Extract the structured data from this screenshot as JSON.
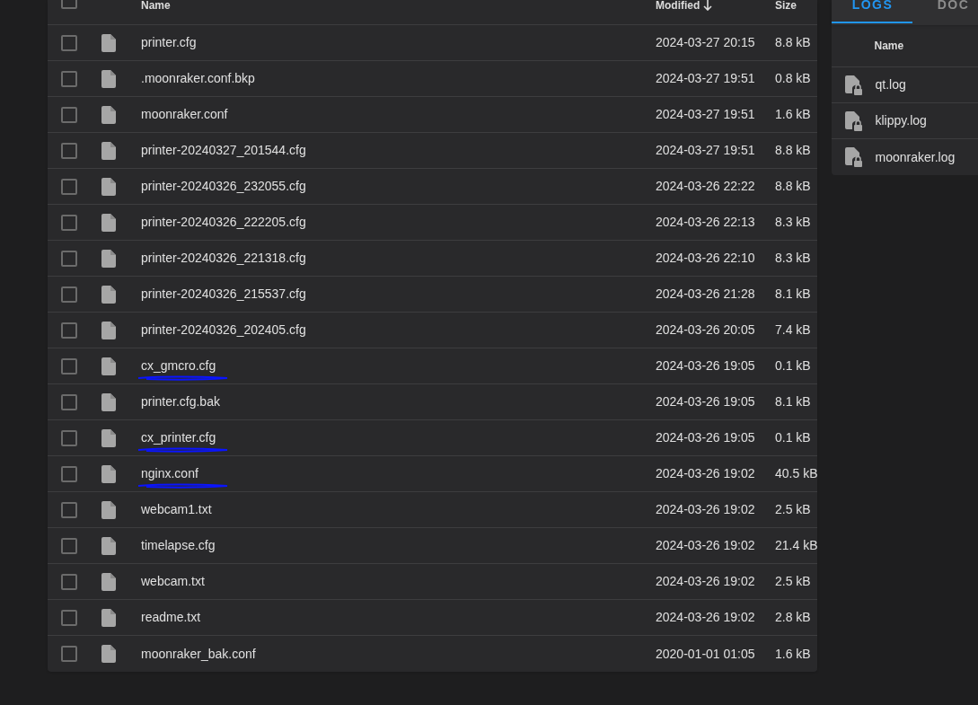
{
  "table": {
    "header": {
      "select_all_checked": false,
      "columns": [
        {
          "label": "Name"
        },
        {
          "label": "Modified",
          "sorted_descending": true
        },
        {
          "label": "Size"
        }
      ]
    },
    "rows": [
      {
        "name": "printer.cfg",
        "modified": "2024-03-27 20:15",
        "size": "8.8 kB",
        "checked": false,
        "annotated": false
      },
      {
        "name": ".moonraker.conf.bkp",
        "modified": "2024-03-27 19:51",
        "size": "0.8 kB",
        "checked": false,
        "annotated": false
      },
      {
        "name": "moonraker.conf",
        "modified": "2024-03-27 19:51",
        "size": "1.6 kB",
        "checked": false,
        "annotated": false
      },
      {
        "name": "printer-20240327_201544.cfg",
        "modified": "2024-03-27 19:51",
        "size": "8.8 kB",
        "checked": false,
        "annotated": false
      },
      {
        "name": "printer-20240326_232055.cfg",
        "modified": "2024-03-26 22:22",
        "size": "8.8 kB",
        "checked": false,
        "annotated": false
      },
      {
        "name": "printer-20240326_222205.cfg",
        "modified": "2024-03-26 22:13",
        "size": "8.3 kB",
        "checked": false,
        "annotated": false
      },
      {
        "name": "printer-20240326_221318.cfg",
        "modified": "2024-03-26 22:10",
        "size": "8.3 kB",
        "checked": false,
        "annotated": false
      },
      {
        "name": "printer-20240326_215537.cfg",
        "modified": "2024-03-26 21:28",
        "size": "8.1 kB",
        "checked": false,
        "annotated": false
      },
      {
        "name": "printer-20240326_202405.cfg",
        "modified": "2024-03-26 20:05",
        "size": "7.4 kB",
        "checked": false,
        "annotated": false
      },
      {
        "name": "cx_gmcro.cfg",
        "modified": "2024-03-26 19:05",
        "size": "0.1 kB",
        "checked": false,
        "annotated": true
      },
      {
        "name": "printer.cfg.bak",
        "modified": "2024-03-26 19:05",
        "size": "8.1 kB",
        "checked": false,
        "annotated": false
      },
      {
        "name": "cx_printer.cfg",
        "modified": "2024-03-26 19:05",
        "size": "0.1 kB",
        "checked": false,
        "annotated": true
      },
      {
        "name": "nginx.conf",
        "modified": "2024-03-26 19:02",
        "size": "40.5 kB",
        "checked": false,
        "annotated": true
      },
      {
        "name": "webcam1.txt",
        "modified": "2024-03-26 19:02",
        "size": "2.5 kB",
        "checked": false,
        "annotated": false
      },
      {
        "name": "timelapse.cfg",
        "modified": "2024-03-26 19:02",
        "size": "21.4 kB",
        "checked": false,
        "annotated": false
      },
      {
        "name": "webcam.txt",
        "modified": "2024-03-26 19:02",
        "size": "2.5 kB",
        "checked": false,
        "annotated": false
      },
      {
        "name": "readme.txt",
        "modified": "2024-03-26 19:02",
        "size": "2.8 kB",
        "checked": false,
        "annotated": false
      },
      {
        "name": "moonraker_bak.conf",
        "modified": "2020-01-01 01:05",
        "size": "1.6 kB",
        "checked": false,
        "annotated": false
      }
    ]
  },
  "side_panel": {
    "tabs": [
      {
        "label": "LOGS",
        "selected": true
      },
      {
        "label": "DOC",
        "selected": false
      }
    ],
    "column": "Name",
    "files": [
      {
        "name": "qt.log"
      },
      {
        "name": "klippy.log"
      },
      {
        "name": "moonraker.log"
      }
    ]
  }
}
